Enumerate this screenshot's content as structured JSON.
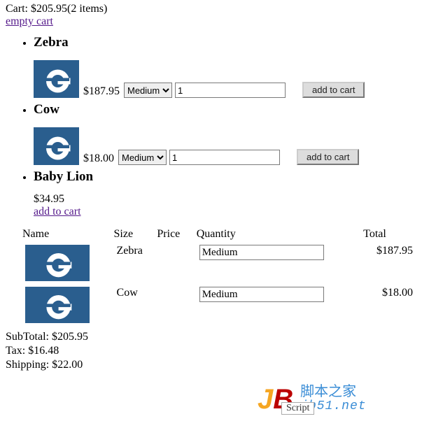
{
  "cart_header": {
    "label": "Cart: ",
    "total": "$205.95",
    "count_text": "(2 items)"
  },
  "empty_cart_link": "empty cart",
  "products": [
    {
      "name": "Zebra",
      "price": "$187.95",
      "size_selected": "Medium",
      "qty": "1",
      "add_label": "add to cart",
      "has_controls": true
    },
    {
      "name": "Cow",
      "price": "$18.00",
      "size_selected": "Medium",
      "qty": "1",
      "add_label": "add to cart",
      "has_controls": true
    },
    {
      "name": "Baby Lion",
      "price": "$34.95",
      "add_label": "add to cart",
      "has_controls": false
    }
  ],
  "cart_table": {
    "headers": [
      "Name",
      "Size",
      "Price",
      "Quantity",
      "Total"
    ],
    "rows": [
      {
        "name": "Zebra",
        "size": "Medium",
        "total": "$187.95"
      },
      {
        "name": "Cow",
        "size": "Medium",
        "total": "$18.00"
      }
    ]
  },
  "totals": {
    "subtotal_label": "SubTotal: ",
    "subtotal": "$205.95",
    "tax_label": "Tax: ",
    "tax": "$16.48",
    "shipping_label": "Shipping: ",
    "shipping": "$22.00"
  },
  "watermark": {
    "cn": "脚本之家",
    "url": "jb51.net",
    "script": "Script"
  }
}
